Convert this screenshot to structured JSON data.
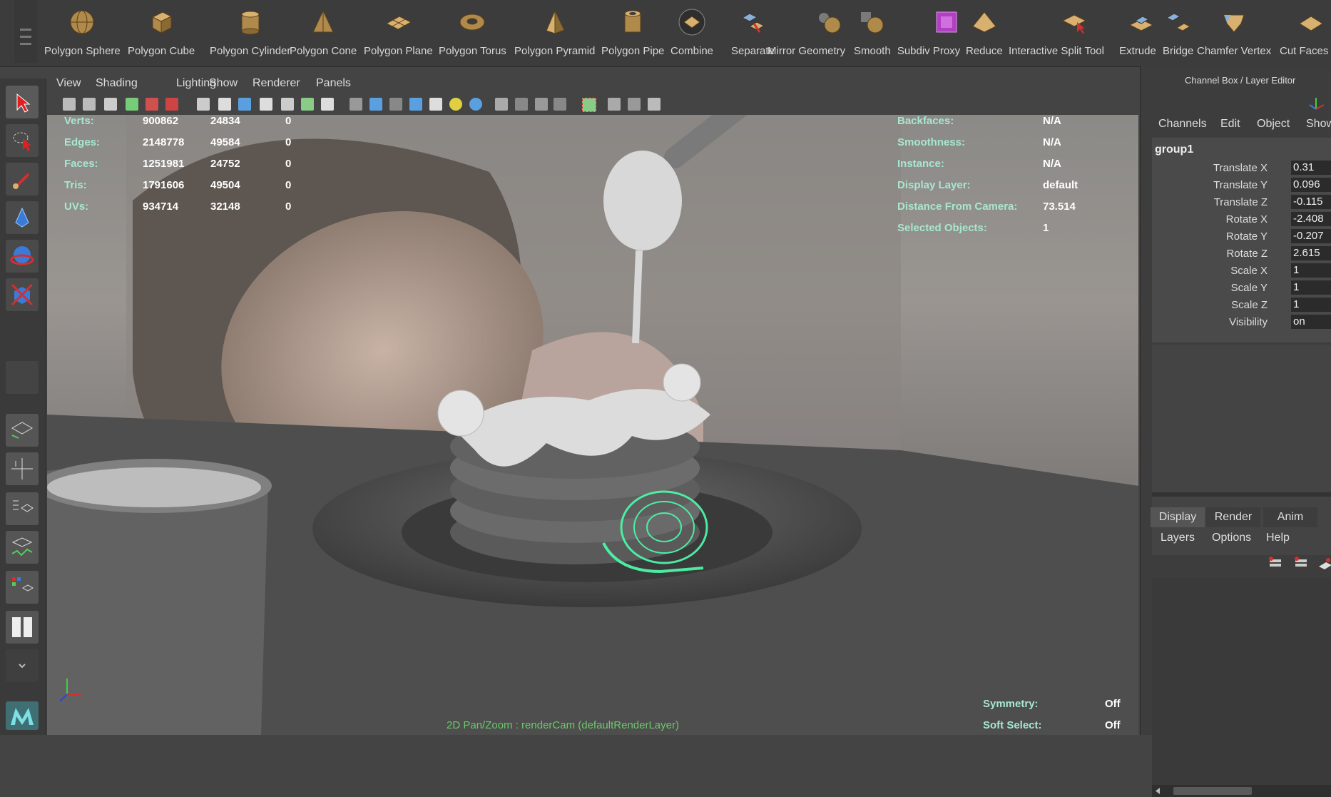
{
  "shelf": {
    "items": [
      {
        "label": "Polygon Sphere",
        "icon": "polygon-sphere-icon"
      },
      {
        "label": "Polygon Cube",
        "icon": "polygon-cube-icon"
      },
      {
        "label": "Polygon Cylinder",
        "icon": "polygon-cylinder-icon"
      },
      {
        "label": "Polygon Cone",
        "icon": "polygon-cone-icon"
      },
      {
        "label": "Polygon Plane",
        "icon": "polygon-plane-icon"
      },
      {
        "label": "Polygon Torus",
        "icon": "polygon-torus-icon"
      },
      {
        "label": "Polygon Pyramid",
        "icon": "polygon-pyramid-icon"
      },
      {
        "label": "Polygon Pipe",
        "icon": "polygon-pipe-icon"
      },
      {
        "label": "Combine",
        "icon": "combine-icon"
      },
      {
        "label": "Separate",
        "icon": "separate-icon"
      },
      {
        "label": "Mirror Geometry",
        "icon": "mirror-geometry-icon"
      },
      {
        "label": "Smooth",
        "icon": "smooth-icon"
      },
      {
        "label": "Subdiv Proxy",
        "icon": "subdiv-proxy-icon"
      },
      {
        "label": "Reduce",
        "icon": "reduce-icon"
      },
      {
        "label": "Interactive Split Tool",
        "icon": "interactive-split-tool-icon"
      },
      {
        "label": "Extrude",
        "icon": "extrude-icon"
      },
      {
        "label": "Bridge",
        "icon": "bridge-icon"
      },
      {
        "label": "Chamfer Vertex",
        "icon": "chamfer-vertex-icon"
      },
      {
        "label": "Cut Faces",
        "icon": "cut-faces-icon"
      }
    ]
  },
  "panel_menu": [
    "View",
    "Shading",
    "Lighting",
    "Show",
    "Renderer",
    "Panels"
  ],
  "hud_left": {
    "rows": [
      {
        "label": "Verts:",
        "a": "900862",
        "b": "24834",
        "c": "0"
      },
      {
        "label": "Edges:",
        "a": "2148778",
        "b": "49584",
        "c": "0"
      },
      {
        "label": "Faces:",
        "a": "1251981",
        "b": "24752",
        "c": "0"
      },
      {
        "label": "Tris:",
        "a": "1791606",
        "b": "49504",
        "c": "0"
      },
      {
        "label": "UVs:",
        "a": "934714",
        "b": "32148",
        "c": "0"
      }
    ]
  },
  "hud_right": {
    "rows": [
      {
        "label": "Backfaces:",
        "value": "N/A"
      },
      {
        "label": "Smoothness:",
        "value": "N/A"
      },
      {
        "label": "Instance:",
        "value": "N/A"
      },
      {
        "label": "Display Layer:",
        "value": "default"
      },
      {
        "label": "Distance From Camera:",
        "value": "73.514"
      },
      {
        "label": "Selected Objects:",
        "value": "1"
      }
    ]
  },
  "hud_bottom": {
    "symmetry_label": "Symmetry:",
    "symmetry_value": "Off",
    "softselect_label": "Soft Select:",
    "softselect_value": "Off",
    "camera_text": "2D Pan/Zoom : renderCam (defaultRenderLayer)"
  },
  "channel_box": {
    "title": "Channel Box / Layer Editor",
    "menu": [
      "Channels",
      "Edit",
      "Object",
      "Show"
    ],
    "object": "group1",
    "attributes": [
      {
        "name": "Translate X",
        "value": "0.31"
      },
      {
        "name": "Translate Y",
        "value": "0.096"
      },
      {
        "name": "Translate Z",
        "value": "-0.115"
      },
      {
        "name": "Rotate X",
        "value": "-2.408"
      },
      {
        "name": "Rotate Y",
        "value": "-0.207"
      },
      {
        "name": "Rotate Z",
        "value": "2.615"
      },
      {
        "name": "Scale X",
        "value": "1"
      },
      {
        "name": "Scale Y",
        "value": "1"
      },
      {
        "name": "Scale Z",
        "value": "1"
      },
      {
        "name": "Visibility",
        "value": "on"
      }
    ]
  },
  "layer_editor": {
    "tabs": [
      "Display",
      "Render",
      "Anim"
    ],
    "menu": [
      "Layers",
      "Options",
      "Help"
    ]
  },
  "colors": {
    "hud_label": "#a7e7d0",
    "hud_value": "#ffffff",
    "selection_green": "#4cf5a8",
    "selected_tool_red": "#d23030"
  }
}
